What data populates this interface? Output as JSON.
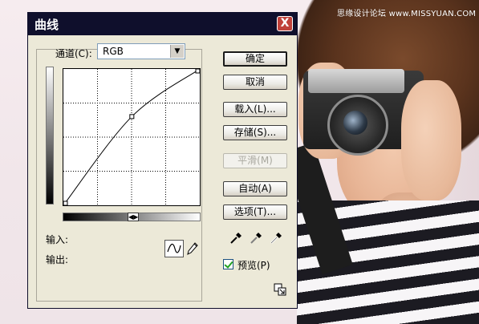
{
  "background": {
    "watermark": "思缘设计论坛 www.MISSYUAN.COM"
  },
  "dialog": {
    "title": "曲线",
    "close_label": "X",
    "channel_label": "通道(C):",
    "channel_value": "RGB",
    "input_label": "输入:",
    "output_label": "输出:",
    "buttons": {
      "ok": "确定",
      "cancel": "取消",
      "load": "载入(L)...",
      "save": "存储(S)...",
      "smooth": "平滑(M)",
      "auto": "自动(A)",
      "options": "选项(T)..."
    },
    "preview_label": "预览(P)",
    "preview_checked": true,
    "curve": {
      "points": [
        [
          0,
          0
        ],
        [
          128,
          166
        ],
        [
          255,
          255
        ]
      ]
    },
    "icons": {
      "curve_tool": "curve-tool-icon",
      "pencil_tool": "pencil-icon",
      "eyedropper_black": "eyedropper-black-icon",
      "eyedropper_gray": "eyedropper-gray-icon",
      "eyedropper_white": "eyedropper-white-icon",
      "resize": "resize-icon"
    }
  }
}
